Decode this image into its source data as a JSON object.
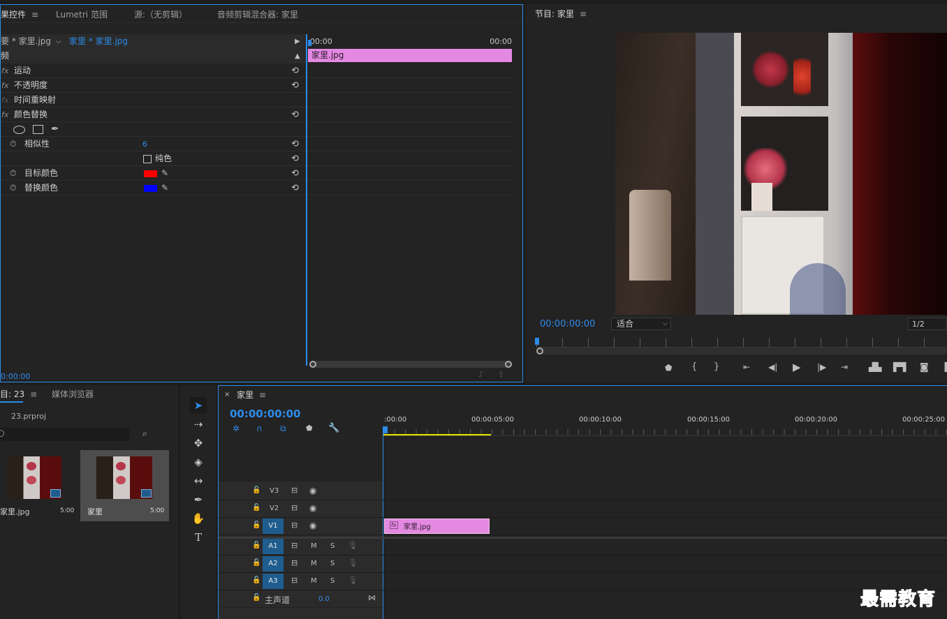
{
  "effect_controls": {
    "tabs": [
      "果控件",
      "Lumetri 范围",
      "源:（无剪辑）",
      "音频剪辑混合器: 家里"
    ],
    "master_clip": "要 * 家里.jpg",
    "sequence_clip": "家里 * 家里.jpg",
    "mini_time_start": "00:00",
    "mini_time_end": "00:00",
    "clip_bar_label": "家里.jpg",
    "section_header": "频",
    "effects": [
      "运动",
      "不透明度",
      "时间重映射",
      "颜色替换"
    ],
    "properties": {
      "similarity_label": "相似性",
      "similarity_value": "6",
      "solid_label": "纯色",
      "target_color_label": "目标颜色",
      "target_color": "#ff0000",
      "replace_color_label": "替换颜色",
      "replace_color": "#0000ff"
    },
    "timecode": "0:00:00"
  },
  "program_monitor": {
    "title": "节目: 家里",
    "timecode": "00:00:00:00",
    "fit_label": "适合",
    "resolution": "1/2"
  },
  "project": {
    "tabs": [
      "目: 23",
      "媒体浏览器"
    ],
    "file_name": "23.prproj",
    "items": [
      {
        "name": "家里.jpg",
        "duration": "5:00"
      },
      {
        "name": "家里",
        "duration": "5:00"
      }
    ]
  },
  "timeline": {
    "sequence_name": "家里",
    "timecode": "00:00:00:00",
    "ruler": [
      ":00:00",
      "00:00:05:00",
      "00:00:10:00",
      "00:00:15:00",
      "00:00:20:00",
      "00:00:25:00"
    ],
    "video_tracks": [
      "V3",
      "V2",
      "V1"
    ],
    "audio_tracks": [
      "A1",
      "A2",
      "A3"
    ],
    "mute_label": "M",
    "solo_label": "S",
    "master_label": "主声道",
    "master_value": "0.0",
    "clip_label": "家里.jpg",
    "clip_fx": "fx"
  },
  "watermark": "最需教育",
  "colors": {
    "accent": "#2d8ceb",
    "clip": "#e489e1",
    "track_target": "#1f5d8f",
    "work_area": "#e6e600"
  }
}
